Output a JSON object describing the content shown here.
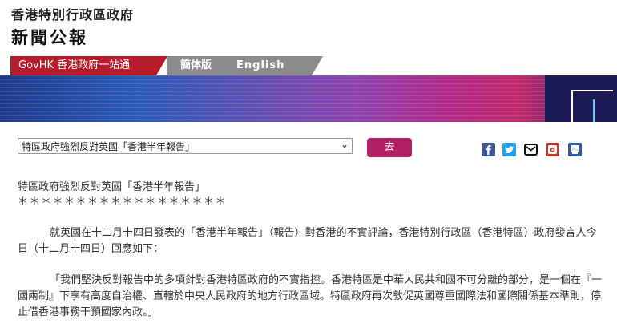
{
  "header": {
    "org_name": "香港特別行政區政府",
    "section_title": "新聞公報"
  },
  "nav": {
    "govhk_label": "GovHK 香港政府一站通",
    "simplified_label": "簡体版",
    "english_label": "English"
  },
  "selector": {
    "selected_value": "特區政府強烈反對英國「香港半年報告」",
    "go_label": "去"
  },
  "share_icons": [
    "facebook-icon",
    "twitter-icon",
    "email-icon",
    "weibo-icon",
    "print-icon"
  ],
  "colors": {
    "govhk_tab": "#b71c2b",
    "go_button": "#b31f63",
    "facebook": "#3b5998",
    "twitter": "#1da1f2"
  },
  "article": {
    "title": "特區政府強烈反對英國「香港半年報告」",
    "stars": "＊＊＊＊＊＊＊＊＊＊＊＊＊＊＊＊＊＊",
    "para1": "就英國在十二月十四日發表的「香港半年報告」（報告）對香港的不實評論，香港特別行政區（香港特區）政府發言人今日（十二月十四日）回應如下：",
    "para2": "「我們堅決反對報告中的多項針對香港特區政府的不實指控。香港特區是中華人民共和國不可分離的部分，是一個在『一國兩制』下享有高度自治權、直轄於中央人民政府的地方行政區域。特區政府再次敦促英國尊重國際法和國際關係基本準則，停止借香港事務干預國家內政。」"
  }
}
